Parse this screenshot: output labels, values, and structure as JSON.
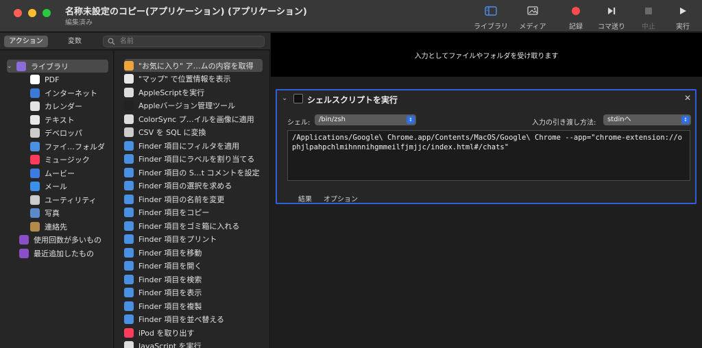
{
  "window": {
    "title": "名称未設定のコピー(アプリケーション) (アプリケーション)",
    "subtitle": "編集済み"
  },
  "toolbar": {
    "library": "ライブラリ",
    "media": "メディア",
    "record": "記録",
    "step": "コマ送り",
    "stop": "中止",
    "run": "実行"
  },
  "library": {
    "segment_actions": "アクション",
    "segment_variables": "変数",
    "search_placeholder": "名前",
    "categories": [
      {
        "label": "ライブラリ",
        "icon": "library-icon",
        "color": "#8a6dd6"
      },
      {
        "label": "PDF",
        "icon": "pdf-icon",
        "color": "#ffffff"
      },
      {
        "label": "インターネット",
        "icon": "globe-icon",
        "color": "#3b7bd6"
      },
      {
        "label": "カレンダー",
        "icon": "calendar-icon",
        "color": "#e4e4e4"
      },
      {
        "label": "テキスト",
        "icon": "text-icon",
        "color": "#e8e8e8"
      },
      {
        "label": "デベロッパ",
        "icon": "developer-icon",
        "color": "#cccccc"
      },
      {
        "label": "ファイ…フォルダ",
        "icon": "finder-icon",
        "color": "#4a90e2"
      },
      {
        "label": "ミュージック",
        "icon": "music-icon",
        "color": "#ff3b5c"
      },
      {
        "label": "ムービー",
        "icon": "movie-icon",
        "color": "#3d7be0"
      },
      {
        "label": "メール",
        "icon": "mail-icon",
        "color": "#3a8fe8"
      },
      {
        "label": "ユーティリティ",
        "icon": "utility-icon",
        "color": "#cccccc"
      },
      {
        "label": "写真",
        "icon": "photos-icon",
        "color": "#5b89c9"
      },
      {
        "label": "連絡先",
        "icon": "contacts-icon",
        "color": "#b38a4a"
      },
      {
        "label": "使用回数が多いもの",
        "icon": "smart-folder-icon",
        "color": "#8a4fc7"
      },
      {
        "label": "最近追加したもの",
        "icon": "smart-folder-icon",
        "color": "#8a4fc7"
      }
    ],
    "actions": [
      {
        "label": "\"お気に入り\" ア…ムの内容を取得",
        "icon": "photos-icon",
        "color": "#f2a33a"
      },
      {
        "label": "\"マップ\" で位置情報を表示",
        "icon": "maps-icon",
        "color": "#e8e8e8"
      },
      {
        "label": "AppleScriptを実行",
        "icon": "applescript-icon",
        "color": "#dddddd"
      },
      {
        "label": "Appleバージョン管理ツール",
        "icon": "terminal-icon",
        "color": "#222222"
      },
      {
        "label": "ColorSync プ…イルを画像に適用",
        "icon": "colorsync-icon",
        "color": "#dddddd"
      },
      {
        "label": "CSV を SQL に変換",
        "icon": "developer-icon",
        "color": "#cccccc"
      },
      {
        "label": "Finder 項目にフィルタを適用",
        "icon": "finder-icon",
        "color": "#4a90e2"
      },
      {
        "label": "Finder 項目にラベルを割り当てる",
        "icon": "finder-icon",
        "color": "#4a90e2"
      },
      {
        "label": "Finder 項目の S…t コメントを設定",
        "icon": "finder-icon",
        "color": "#4a90e2"
      },
      {
        "label": "Finder 項目の選択を求める",
        "icon": "finder-icon",
        "color": "#4a90e2"
      },
      {
        "label": "Finder 項目の名前を変更",
        "icon": "finder-icon",
        "color": "#4a90e2"
      },
      {
        "label": "Finder 項目をコピー",
        "icon": "finder-icon",
        "color": "#4a90e2"
      },
      {
        "label": "Finder 項目をゴミ箱に入れる",
        "icon": "finder-icon",
        "color": "#4a90e2"
      },
      {
        "label": "Finder 項目をプリント",
        "icon": "finder-icon",
        "color": "#4a90e2"
      },
      {
        "label": "Finder 項目を移動",
        "icon": "finder-icon",
        "color": "#4a90e2"
      },
      {
        "label": "Finder 項目を開く",
        "icon": "finder-icon",
        "color": "#4a90e2"
      },
      {
        "label": "Finder 項目を検索",
        "icon": "finder-icon",
        "color": "#4a90e2"
      },
      {
        "label": "Finder 項目を表示",
        "icon": "finder-icon",
        "color": "#4a90e2"
      },
      {
        "label": "Finder 項目を複製",
        "icon": "finder-icon",
        "color": "#4a90e2"
      },
      {
        "label": "Finder 項目を並べ替える",
        "icon": "finder-icon",
        "color": "#4a90e2"
      },
      {
        "label": "iPod を取り出す",
        "icon": "music-icon",
        "color": "#ff3b5c"
      },
      {
        "label": "JavaScript を実行",
        "icon": "applescript-icon",
        "color": "#dddddd"
      }
    ]
  },
  "workflow": {
    "header": "入力としてファイルやフォルダを受け取ります",
    "action": {
      "title": "シェルスクリプトを実行",
      "shell_label": "シェル:",
      "shell_value": "/bin/zsh",
      "pass_label": "入力の引き渡し方法:",
      "pass_value": "stdinへ",
      "script": "/Applications/Google\\ Chrome.app/Contents/MacOS/Google\\ Chrome --app=\"chrome-extension://ophjlpahpchlmihnnnihgmmeilfjmjjc/index.html#/chats\"",
      "tab_results": "結果",
      "tab_options": "オプション"
    }
  },
  "colors": {
    "selection_border": "#2f5fd9",
    "record": "#ff4b4b"
  }
}
